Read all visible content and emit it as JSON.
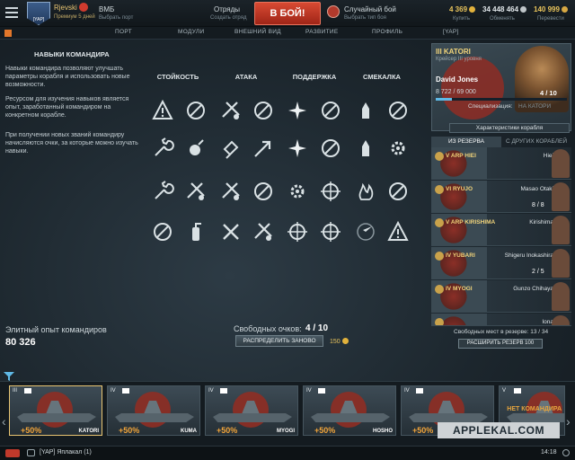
{
  "topbar": {
    "username": "Rjevski",
    "premium": "Премиум 5 дней",
    "clan_badge": "[YAP]",
    "vmb_title": "ВМБ",
    "vmb_sub": "Выбрать порт",
    "squads_title": "Отряды",
    "squads_sub": "Создать отряд",
    "battle_button": "В БОЙ!",
    "mode_title": "Случайный бой",
    "mode_sub": "Выбрать тип боя",
    "doubloons": "4 369",
    "doubloons_sub": "Купить",
    "credits": "34 448 464",
    "credits_sub": "Обменять",
    "free_xp": "140 999",
    "free_xp_sub": "Перевести",
    "colors": {
      "battle": "#c8381f",
      "gold": "#e8c572"
    }
  },
  "nav": {
    "tabs": [
      "ПОРТ",
      "МОДУЛИ",
      "ВНЕШНИЙ ВИД",
      "РАЗВИТИЕ",
      "ПРОФИЛЬ",
      "[YAP]"
    ]
  },
  "info": {
    "title": "НАВЫКИ КОМАНДИРА",
    "p1": "Навыки командира позволяют улучшать параметры корабля и использовать новые возможности.",
    "p2": "Ресурсом для изучения навыков является опыт, заработанный командиром на конкретном корабле.",
    "p3": "При получении новых званий командиру начисляются очки, за которые можно изучать навыки."
  },
  "skills": {
    "columns": [
      "СТОЙКОСТЬ",
      "АТАКА",
      "ПОДДЕРЖКА",
      "СМЕКАЛКА"
    ]
  },
  "points": {
    "free_label": "Свободных очков:",
    "free_value": "4 / 10",
    "redistribute": "РАСПРЕДЕЛИТЬ ЗАНОВО",
    "redistribute_cost": "150",
    "elite_label": "Элитный опыт командиров",
    "elite_value": "80 326"
  },
  "commander": {
    "ship": "III KATORI",
    "ship_sub": "Крейсер III уровня",
    "name": "David Jones",
    "xp": "8 722 / 69 000",
    "xp_progress": 0.126,
    "points": "4 / 10",
    "spec_label": "Специализация:",
    "spec_value": "НА КАТОРИ",
    "chars_button": "Характеристики корабля"
  },
  "reserve": {
    "tab_active": "ИЗ РЕЗЕРВА",
    "tab_other": "С ДРУГИХ КОРАБЛЕЙ",
    "rows": [
      {
        "ship": "V ARP HIEI",
        "name": "Hiei",
        "points": ""
      },
      {
        "ship": "VI RYUJO",
        "name": "Masao Otaki",
        "points": "8 / 8"
      },
      {
        "ship": "V ARP KIRISHIMA",
        "name": "Kirishima",
        "points": ""
      },
      {
        "ship": "IV YUBARI",
        "name": "Shigeru Inokashira",
        "points": "2 / 5"
      },
      {
        "ship": "IV MYOGI",
        "name": "Gunzo Chihaya",
        "points": ""
      },
      {
        "ship": "",
        "name": "Iona",
        "points": ""
      }
    ],
    "free_slots": "Свободных мест в резерве: 13 / 34",
    "expand": "РАСШИРИТЬ РЕЗЕРВ  100"
  },
  "carousel": {
    "ships": [
      {
        "tier": "III",
        "name": "KATORI",
        "bonus": "+50%"
      },
      {
        "tier": "IV",
        "name": "KUMA",
        "bonus": "+50%"
      },
      {
        "tier": "IV",
        "name": "MYOGI",
        "bonus": "+50%"
      },
      {
        "tier": "IV",
        "name": "HOSHO",
        "bonus": "+50%"
      },
      {
        "tier": "IV",
        "name": "YUBARI",
        "bonus": "+50%"
      },
      {
        "tier": "V",
        "name": "",
        "bonus": "",
        "no_commander": "НЕТ КОМАНДИРА"
      }
    ]
  },
  "watermark": "APPLEKAL.COM",
  "bottombar": {
    "chat": "[YAP] Яплакал (1)",
    "time": "14:18"
  }
}
